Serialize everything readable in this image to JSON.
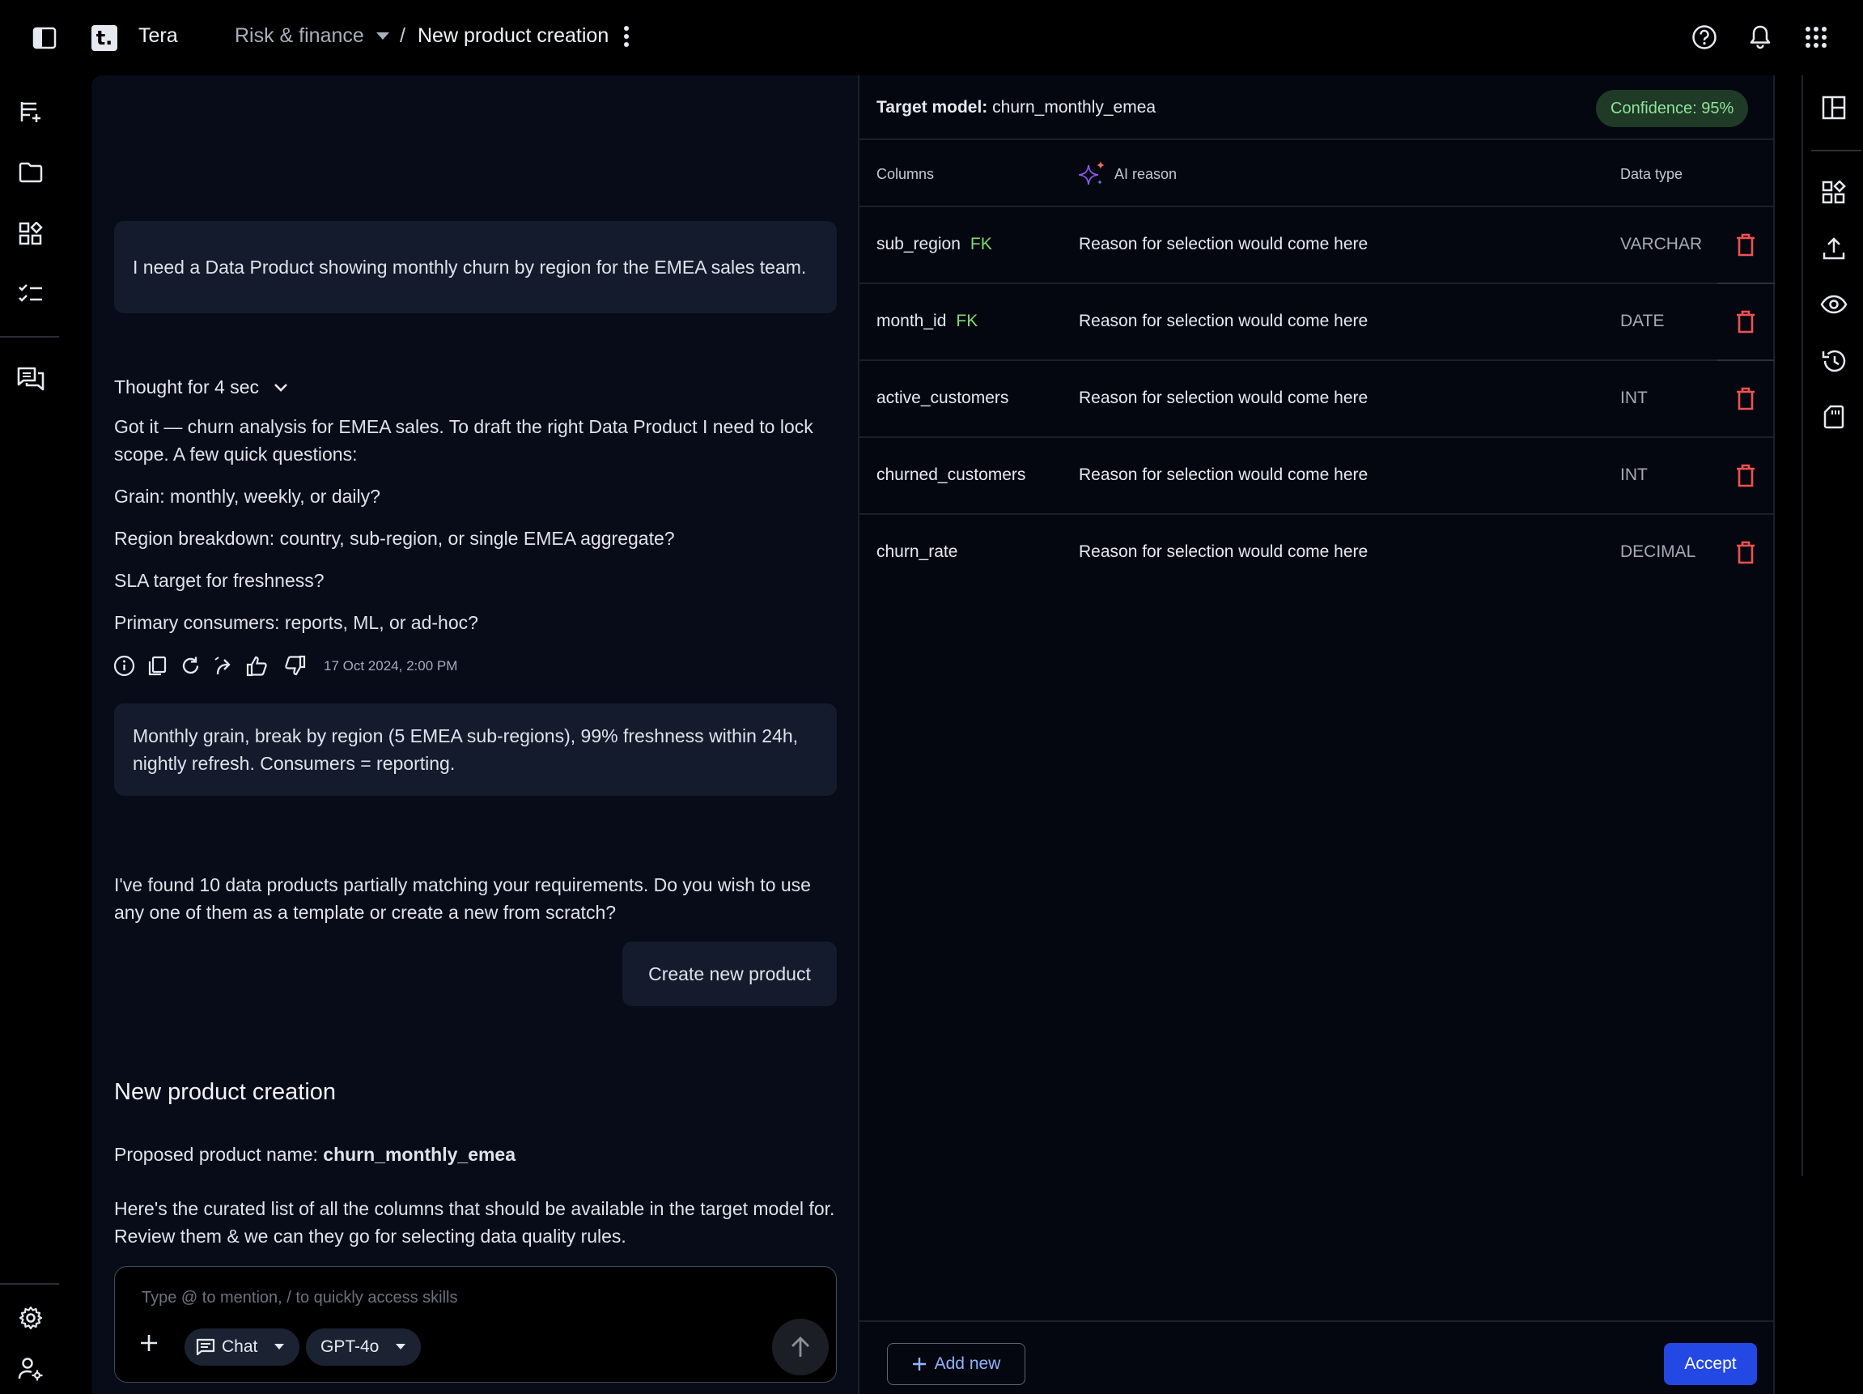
{
  "app": {
    "name": "Tera",
    "logo_letter": "t."
  },
  "breadcrumb": {
    "parent": "Risk & finance",
    "separator": "/",
    "current": "New product creation"
  },
  "chat": {
    "user_message_1": "I need a Data Product showing monthly churn by region for the EMEA sales team.",
    "thought_label": "Thought for 4 sec",
    "ai_intro": "Got it — churn analysis for EMEA sales. To draft the right Data Product I need to lock scope. A few quick questions:",
    "questions": [
      "Grain: monthly, weekly, or daily?",
      "Region breakdown: country, sub-region, or single EMEA aggregate?",
      "SLA target for freshness?",
      "Primary consumers: reports, ML, or ad-hoc?"
    ],
    "timestamp": "17 Oct 2024, 2:00 PM",
    "user_message_2": "Monthly grain, break by region (5 EMEA sub-regions), 99% freshness within 24h, nightly refresh. Consumers = reporting.",
    "ai_found": "I've found 10 data products partially matching your requirements. Do you wish to use any one of them as a template or create a new from scratch?",
    "create_new_label": "Create new product",
    "section_title": "New product creation",
    "proposed_label": "Proposed product name: ",
    "proposed_name": "churn_monthly_emea",
    "curated_text": "Here's the curated list of all the columns that should be available in the target model for. Review them & we can they go for selecting data quality rules.",
    "composer": {
      "placeholder": "Type @ to mention, / to quickly access skills",
      "mode_label": "Chat",
      "model_label": "GPT-4o"
    }
  },
  "model_panel": {
    "title_prefix": "Target model:",
    "title_value": "churn_monthly_emea",
    "confidence": "Confidence: 95%",
    "headers": {
      "columns": "Columns",
      "reason": "AI reason",
      "data_type": "Data type"
    },
    "rows": [
      {
        "name": "sub_region",
        "badge": "FK",
        "reason": "Reason for selection would come here",
        "type": "VARCHAR"
      },
      {
        "name": "month_id",
        "badge": "FK",
        "reason": "Reason for selection would come here",
        "type": "DATE"
      },
      {
        "name": "active_customers",
        "badge": "",
        "reason": "Reason for selection would come here",
        "type": "INT"
      },
      {
        "name": "churned_customers",
        "badge": "",
        "reason": "Reason for selection would come here",
        "type": "INT"
      },
      {
        "name": "churn_rate",
        "badge": "",
        "reason": "Reason for selection would come here",
        "type": "DECIMAL"
      }
    ],
    "add_new_label": "Add new",
    "accept_label": "Accept"
  },
  "colors": {
    "accent": "#2448e3",
    "fk_green": "#7ddc6c",
    "delete_red": "#f05252",
    "confidence_bg": "#1f3a27",
    "confidence_text": "#8fe39a"
  }
}
